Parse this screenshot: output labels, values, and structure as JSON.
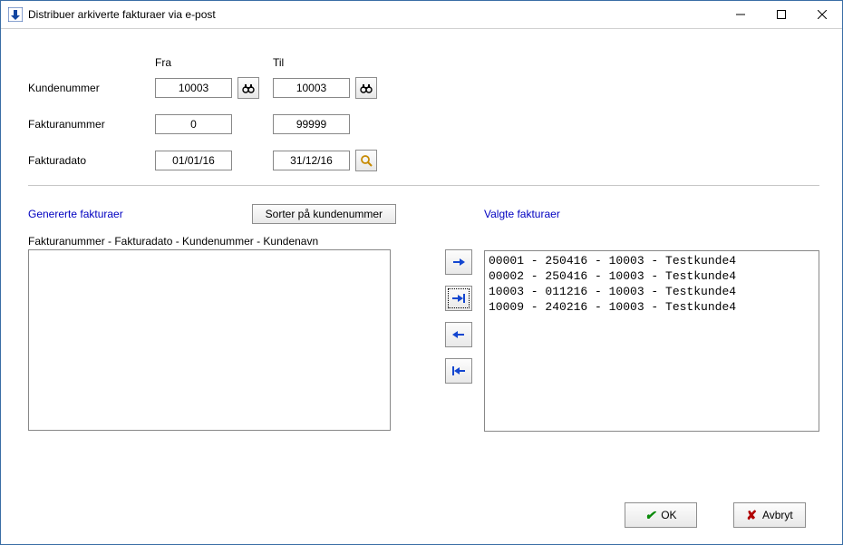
{
  "window": {
    "title": "Distribuer arkiverte fakturaer via e-post"
  },
  "headers": {
    "fra": "Fra",
    "til": "Til"
  },
  "labels": {
    "kundenummer": "Kundenummer",
    "fakturanummer": "Fakturanummer",
    "fakturadato": "Fakturadato",
    "genererte": "Genererte fakturaer",
    "valgte": "Valgte fakturaer",
    "list_caption": "Fakturanummer - Fakturadato - Kundenummer - Kundenavn"
  },
  "filters": {
    "kundenummer": {
      "fra": "10003",
      "til": "10003"
    },
    "fakturanummer": {
      "fra": "0",
      "til": "99999"
    },
    "fakturadato": {
      "fra": "01/01/16",
      "til": "31/12/16"
    }
  },
  "buttons": {
    "sort": "Sorter på kundenummer",
    "ok": "OK",
    "avbryt": "Avbryt"
  },
  "generated_invoices": [],
  "selected_invoices": [
    {
      "nr": "00001",
      "dato": "250416",
      "kunde": "10003",
      "navn": "Testkunde4"
    },
    {
      "nr": "00002",
      "dato": "250416",
      "kunde": "10003",
      "navn": "Testkunde4"
    },
    {
      "nr": "10003",
      "dato": "011216",
      "kunde": "10003",
      "navn": "Testkunde4"
    },
    {
      "nr": "10009",
      "dato": "240216",
      "kunde": "10003",
      "navn": "Testkunde4"
    }
  ]
}
